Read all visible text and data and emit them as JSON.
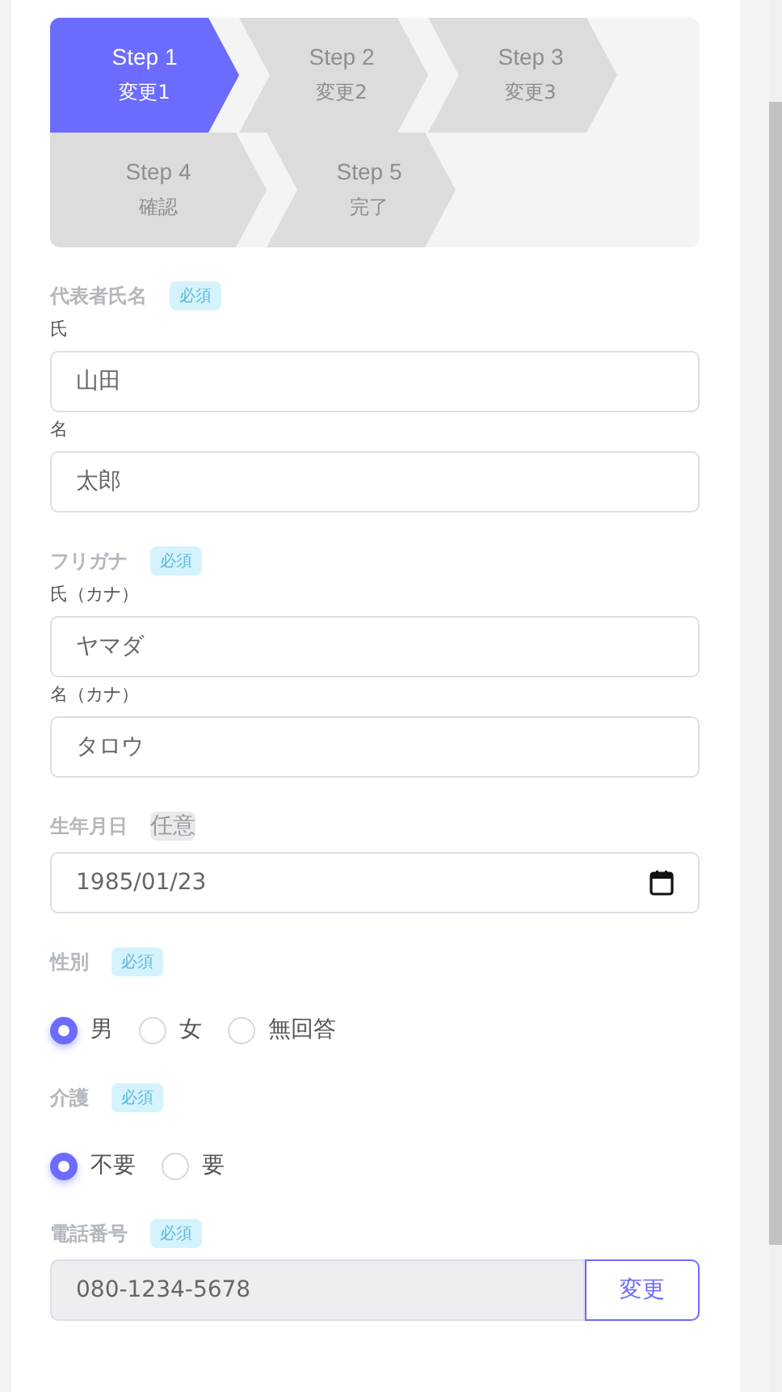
{
  "steps": [
    {
      "title": "Step 1",
      "label": "変更1",
      "selected": true
    },
    {
      "title": "Step 2",
      "label": "変更2",
      "selected": false
    },
    {
      "title": "Step 3",
      "label": "変更3",
      "selected": false
    },
    {
      "title": "Step 4",
      "label": "確認",
      "selected": false
    },
    {
      "title": "Step 5",
      "label": "完了",
      "selected": false
    }
  ],
  "sections": [
    {
      "kind": "text",
      "label": "代表者氏名",
      "badge": {
        "text": "必須",
        "required": true
      },
      "fields": [
        {
          "label": "氏",
          "value": "山田"
        },
        {
          "label": "名",
          "value": "太郎"
        }
      ]
    },
    {
      "kind": "text",
      "label": "フリガナ",
      "badge": {
        "text": "必須",
        "required": true
      },
      "fields": [
        {
          "label": "氏（カナ）",
          "value": "ヤマダ"
        },
        {
          "label": "名（カナ）",
          "value": "タロウ"
        }
      ]
    },
    {
      "kind": "date",
      "label": "生年月日",
      "badge": {
        "text": "任意",
        "required": false
      },
      "value": "1985/01/23"
    },
    {
      "kind": "radio",
      "label": "性別",
      "badge": {
        "text": "必須",
        "required": true
      },
      "options": [
        {
          "label": "男",
          "selected": true
        },
        {
          "label": "女",
          "selected": false
        },
        {
          "label": "無回答",
          "selected": false
        }
      ]
    },
    {
      "kind": "radio",
      "label": "介護",
      "badge": {
        "text": "必須",
        "required": true
      },
      "options": [
        {
          "label": "不要",
          "selected": true
        },
        {
          "label": "要",
          "selected": false
        }
      ]
    },
    {
      "kind": "phone",
      "label": "電話番号",
      "badge": {
        "text": "必須",
        "required": true
      },
      "value": "080-1234-5678",
      "disabled": true,
      "button": "変更"
    }
  ]
}
